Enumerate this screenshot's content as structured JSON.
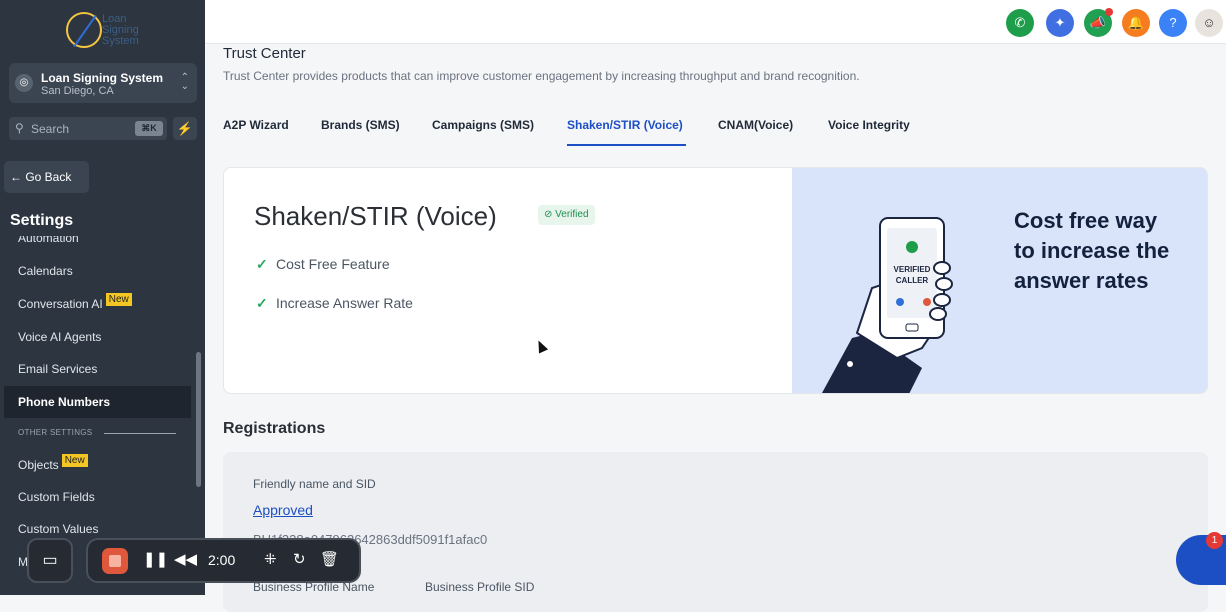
{
  "sidebar": {
    "logo_text": "Loan Signing System",
    "account": {
      "name": "Loan Signing System",
      "location": "San Diego, CA"
    },
    "search": {
      "placeholder": "Search",
      "shortcut": "⌘K"
    },
    "go_back": "← Go Back",
    "title": "Settings",
    "items": [
      {
        "label": "Automation"
      },
      {
        "label": "Calendars"
      },
      {
        "label": "Conversation AI",
        "badge": "New"
      },
      {
        "label": "Voice AI Agents"
      },
      {
        "label": "Email Services"
      },
      {
        "label": "Phone Numbers"
      },
      {
        "label": "Objects",
        "badge": "New"
      },
      {
        "label": "Custom Fields"
      },
      {
        "label": "Custom Values"
      },
      {
        "label": "M"
      }
    ],
    "other_settings_label": "OTHER SETTINGS"
  },
  "page": {
    "title": "Trust Center",
    "description": "Trust Center provides products that can improve customer engagement by increasing throughput and brand recognition.",
    "tabs": [
      {
        "label": "A2P Wizard"
      },
      {
        "label": "Brands (SMS)"
      },
      {
        "label": "Campaigns (SMS)"
      },
      {
        "label": "Shaken/STIR (Voice)"
      },
      {
        "label": "CNAM(Voice)"
      },
      {
        "label": "Voice Integrity"
      }
    ]
  },
  "card": {
    "title": "Shaken/STIR (Voice)",
    "status": "Verified",
    "features": [
      "Cost Free Feature",
      "Increase Answer Rate"
    ],
    "promo": "Cost free way to increase the answer rates",
    "phone_text_1": "VERIFIED",
    "phone_text_2": "CALLER"
  },
  "registrations": {
    "title": "Registrations",
    "friendly_label": "Friendly name and SID",
    "status": "Approved",
    "sid": "BU1f328a047962642863ddf5091f1afac0",
    "col1": "Business Profile Name",
    "col2": "Business Profile SID"
  },
  "recorder": {
    "time": "2:00"
  },
  "chat": {
    "badge": "1"
  },
  "colors": {
    "accent": "#1d4fc4",
    "sidebar": "#2c3540",
    "success": "#2aa760"
  }
}
